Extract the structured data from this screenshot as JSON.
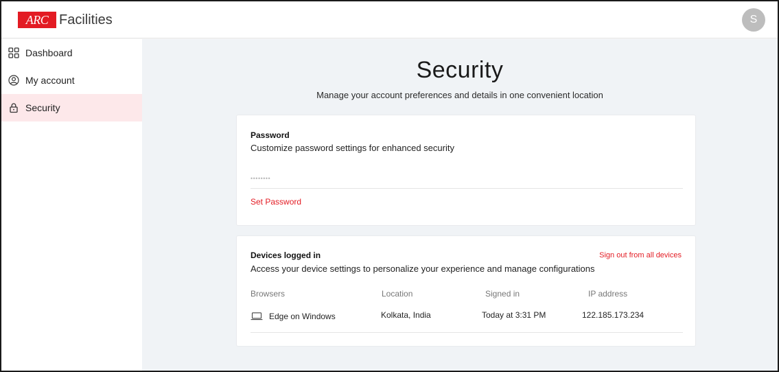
{
  "header": {
    "logo_mark": "ARC",
    "logo_text": "Facilities",
    "avatar_initial": "S"
  },
  "sidebar": {
    "items": [
      {
        "label": "Dashboard",
        "icon": "grid-icon"
      },
      {
        "label": "My account",
        "icon": "user-circle-icon"
      },
      {
        "label": "Security",
        "icon": "lock-icon",
        "active": true
      }
    ]
  },
  "main": {
    "title": "Security",
    "subtitle": "Manage your account preferences and details in one convenient location"
  },
  "password_card": {
    "title": "Password",
    "description": "Customize password settings for enhanced security",
    "masked_value": "••••••••",
    "action_label": "Set Password"
  },
  "devices_card": {
    "title": "Devices logged in",
    "signout_all_label": "Sign out from all devices",
    "description": "Access your device settings to personalize your experience and manage configurations",
    "columns": [
      "Browsers",
      "Location",
      "Signed in",
      "IP address"
    ],
    "rows": [
      {
        "browser": "Edge on Windows",
        "location": "Kolkata, India",
        "signed_in": "Today at 3:31 PM",
        "ip": "122.185.173.234",
        "icon": "laptop-icon"
      }
    ]
  },
  "colors": {
    "accent": "#e31b23",
    "active_nav_bg": "#fde8ea",
    "main_bg": "#f0f3f6"
  }
}
